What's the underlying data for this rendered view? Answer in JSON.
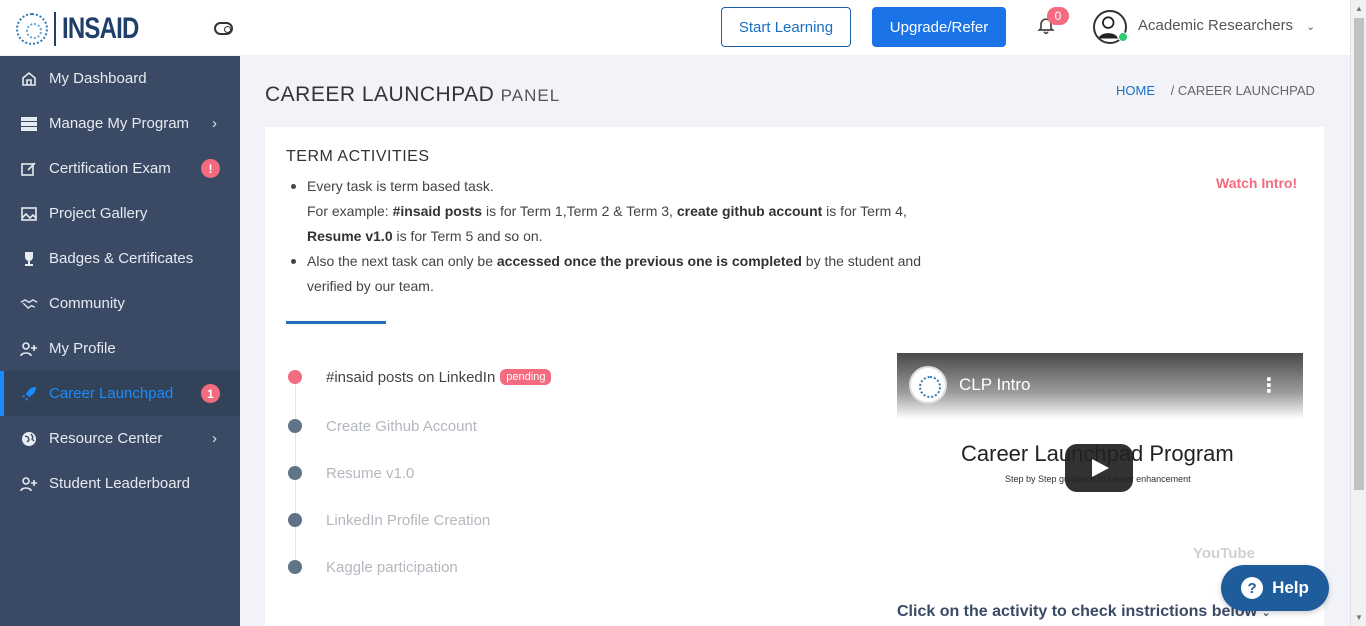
{
  "header": {
    "logo_text": "INSAID",
    "start_learning": "Start Learning",
    "upgrade_refer": "Upgrade/Refer",
    "notification_count": "0",
    "user_name": "Academic Researchers",
    "user_chevron_icon": "chevron-down-icon"
  },
  "sidebar": {
    "items": [
      {
        "label": "My Dashboard",
        "icon": "home-icon"
      },
      {
        "label": "Manage My Program",
        "icon": "server-icon",
        "chevron": "›"
      },
      {
        "label": "Certification Exam",
        "icon": "edit-icon",
        "badge": "!"
      },
      {
        "label": "Project Gallery",
        "icon": "image-icon"
      },
      {
        "label": "Badges & Certificates",
        "icon": "trophy-icon"
      },
      {
        "label": "Community",
        "icon": "handshake-icon"
      },
      {
        "label": "My Profile",
        "icon": "user-plus-icon"
      },
      {
        "label": "Career Launchpad",
        "icon": "rocket-icon",
        "badge": "1",
        "active": true
      },
      {
        "label": "Resource Center",
        "icon": "globe-icon",
        "chevron": "›"
      },
      {
        "label": "Student Leaderboard",
        "icon": "user-plus-icon"
      }
    ]
  },
  "page": {
    "title": "CAREER LAUNCHPAD",
    "title_suffix": "PANEL",
    "breadcrumb_home": "HOME",
    "breadcrumb_sep": "/",
    "breadcrumb_current": "CAREER LAUNCHPAD"
  },
  "term": {
    "title": "TERM ACTIVITIES",
    "watch_intro": "Watch Intro!",
    "line1": "Every task is term based task.",
    "line2_a": "For example: ",
    "line2_b": "#insaid posts",
    "line2_c": " is for Term 1,Term 2 & Term 3, ",
    "line2_d": "create github account",
    "line2_e": " is for Term 4,",
    "line3_a": "Resume v1.0",
    "line3_b": " is for Term 5 and so on.",
    "line4_a": "Also the next task can only be ",
    "line4_b": "accessed once the previous one is completed",
    "line4_c": " by the student and",
    "line5": "verified by our team."
  },
  "activities": [
    {
      "label": "#insaid posts on LinkedIn",
      "status": "pending"
    },
    {
      "label": "Create Github Account"
    },
    {
      "label": "Resume v1.0"
    },
    {
      "label": "LinkedIn Profile Creation"
    },
    {
      "label": "Kaggle participation"
    }
  ],
  "video": {
    "title": "CLP Intro",
    "heading": "Career Launchpad Program",
    "caption": "Step by Step guidance to career enhancement",
    "watermark": "YouTube"
  },
  "click_hint": "Click on the activity to check instrictions below",
  "help_label": "Help",
  "colors": {
    "sidebar_bg": "#3a4a64",
    "accent": "#1a74e8",
    "badge": "#f36b7f"
  }
}
